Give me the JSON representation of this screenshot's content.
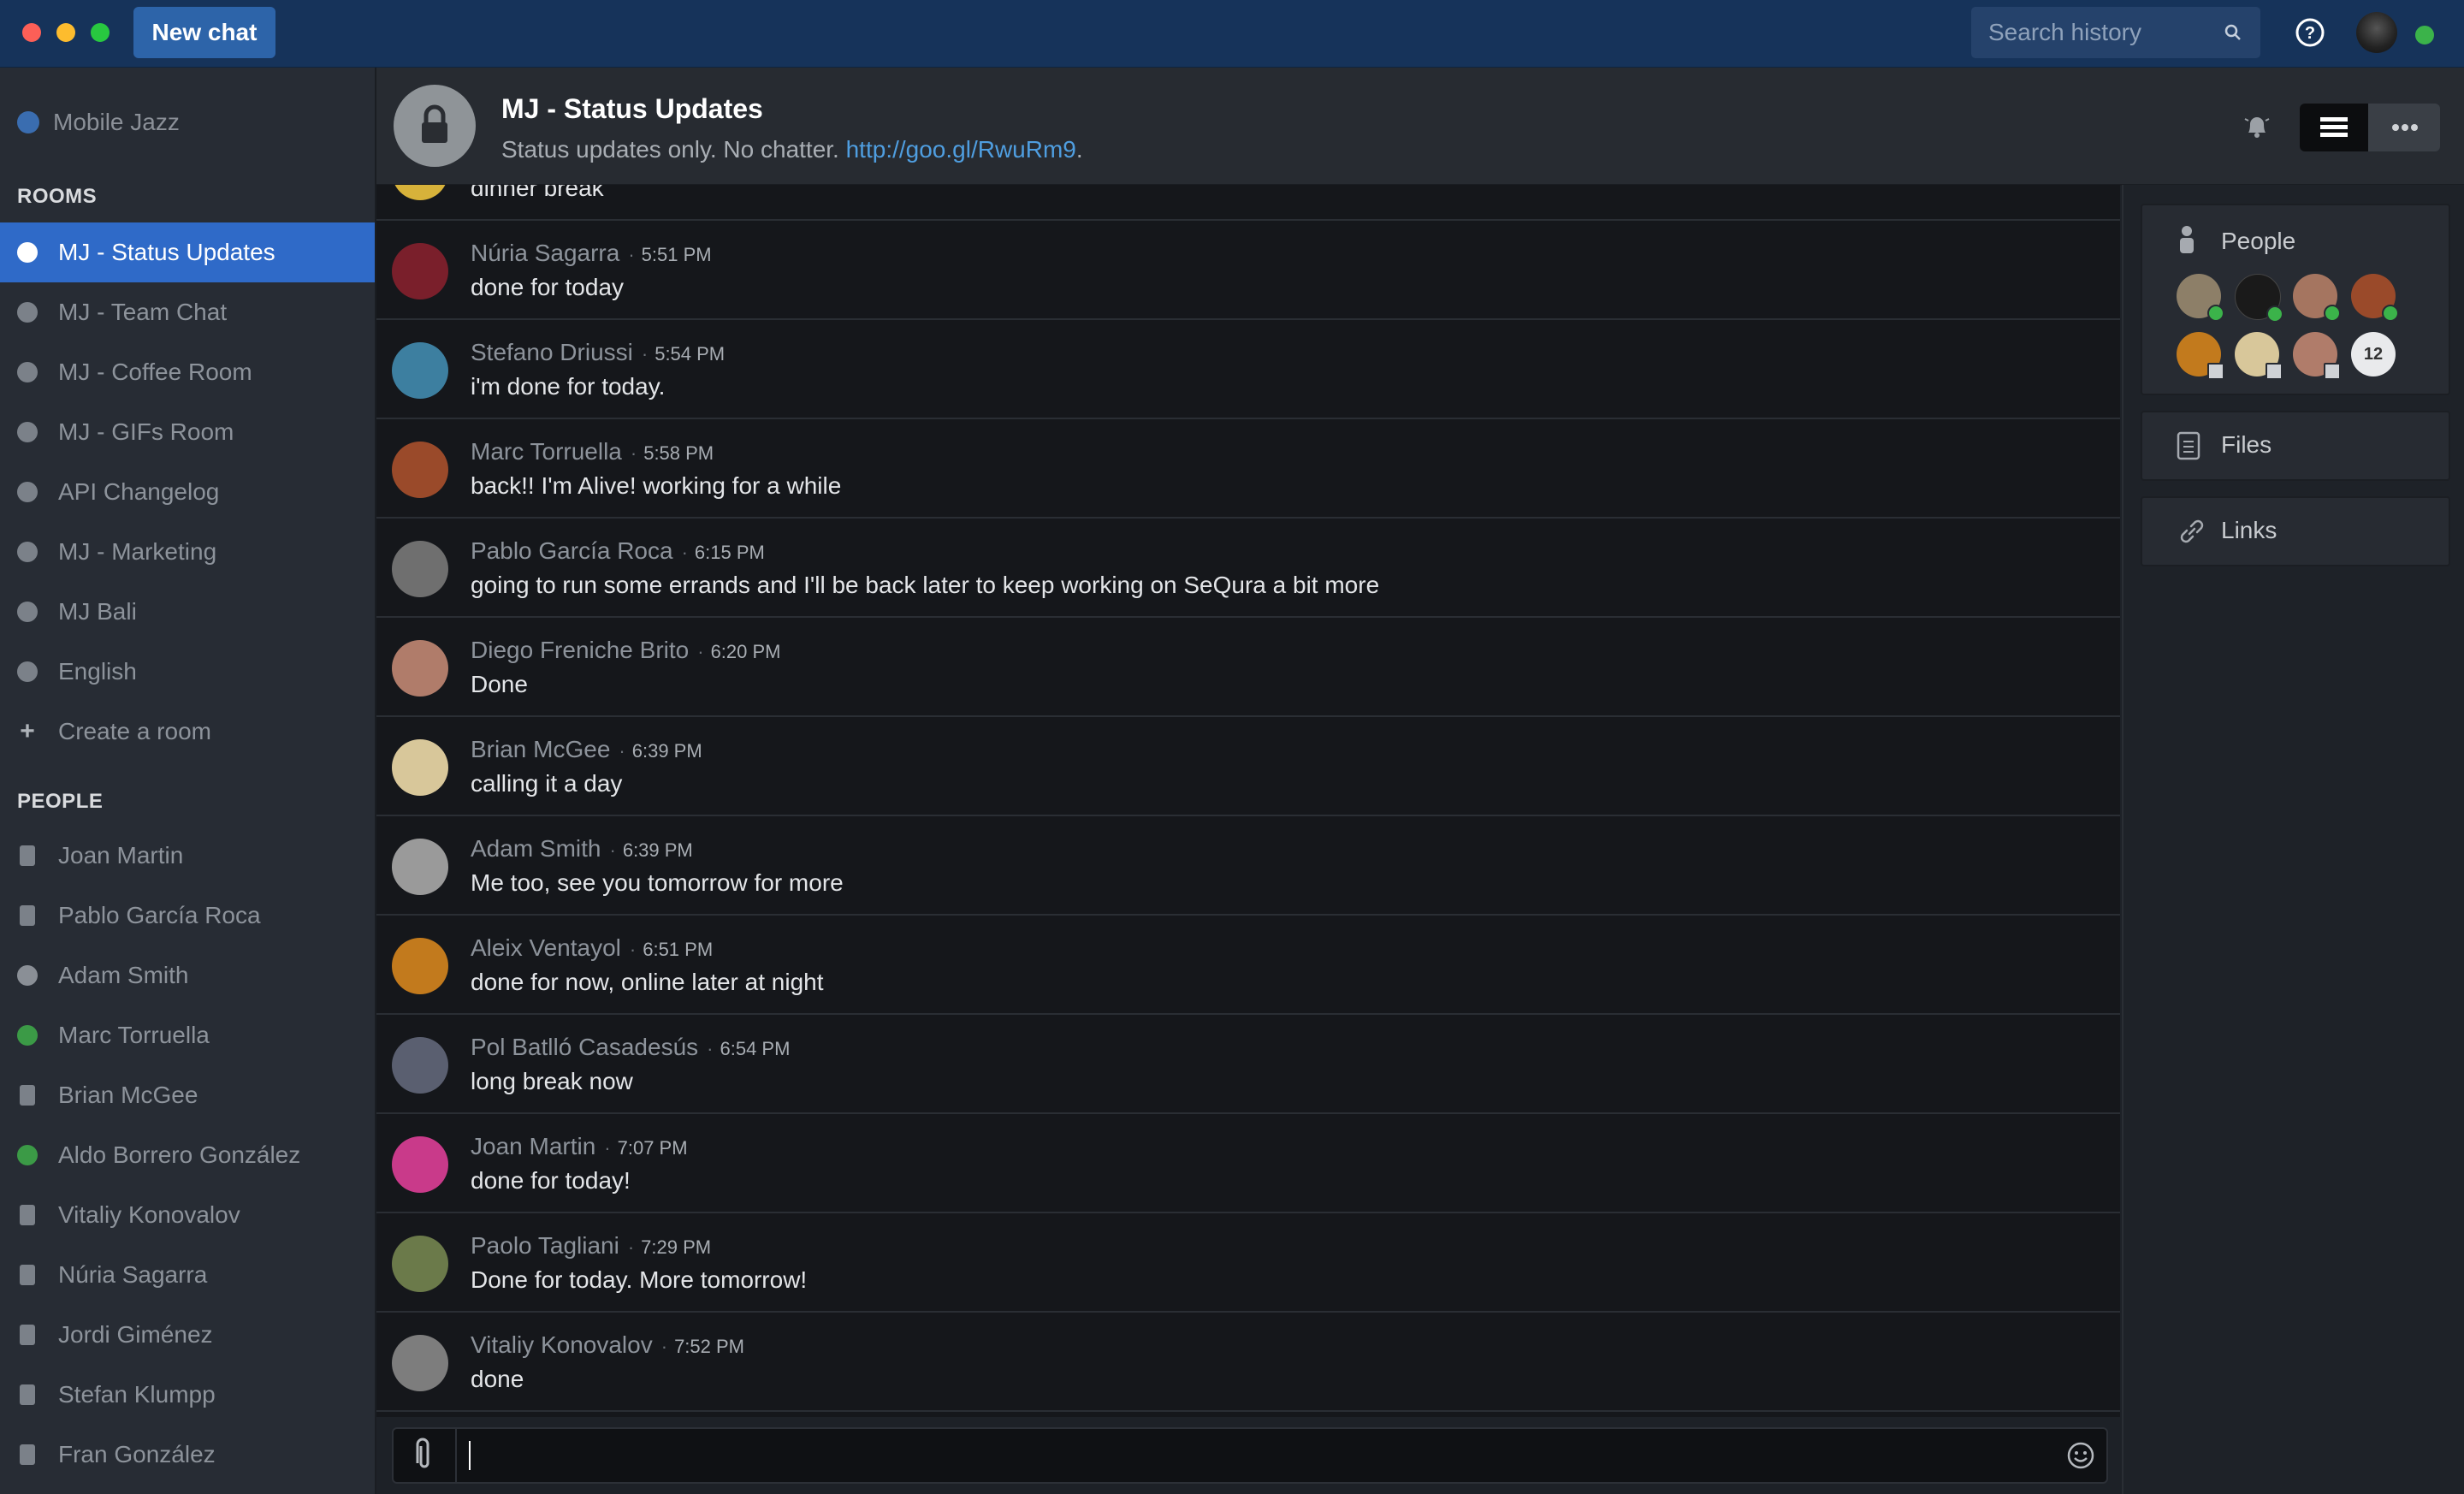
{
  "titlebar": {
    "new_chat_label": "New chat",
    "search_placeholder": "Search history"
  },
  "sidebar": {
    "team_name": "Mobile Jazz",
    "rooms_heading": "ROOMS",
    "rooms": [
      {
        "label": "MJ - Status Updates",
        "icon": "lock-icon",
        "active": true
      },
      {
        "label": "MJ - Team Chat",
        "icon": "lock-icon"
      },
      {
        "label": "MJ - Coffee Room",
        "icon": "room-icon"
      },
      {
        "label": "MJ - GIFs Room",
        "icon": "room-icon"
      },
      {
        "label": "API Changelog",
        "icon": "room-icon"
      },
      {
        "label": "MJ - Marketing",
        "icon": "room-icon"
      },
      {
        "label": "MJ Bali",
        "icon": "room-icon"
      },
      {
        "label": "English",
        "icon": "room-icon"
      }
    ],
    "create_room_label": "Create a room",
    "people_heading": "PEOPLE",
    "people": [
      {
        "label": "Joan Martin",
        "status": "mobile"
      },
      {
        "label": "Pablo García Roca",
        "status": "mobile"
      },
      {
        "label": "Adam Smith",
        "status": "away"
      },
      {
        "label": "Marc Torruella",
        "status": "online"
      },
      {
        "label": "Brian McGee",
        "status": "mobile"
      },
      {
        "label": "Aldo Borrero González",
        "status": "online"
      },
      {
        "label": "Vitaliy Konovalov",
        "status": "mobile"
      },
      {
        "label": "Núria Sagarra",
        "status": "mobile"
      },
      {
        "label": "Jordi Giménez",
        "status": "mobile"
      },
      {
        "label": "Stefan Klumpp",
        "status": "mobile"
      },
      {
        "label": "Fran González",
        "status": "mobile"
      }
    ]
  },
  "header": {
    "room_title": "MJ - Status Updates",
    "topic_text": "Status updates only. No chatter. ",
    "topic_link": "http://goo.gl/RwuRm9",
    "topic_end": "."
  },
  "messages": {
    "partial_text": "dinner break",
    "items": [
      {
        "author": "Núria Sagarra",
        "time": "5:51 PM",
        "text": "done for today",
        "avatar_color": "#7a1f2b"
      },
      {
        "author": "Stefano Driussi",
        "time": "5:54 PM",
        "text": "i'm done for today.",
        "avatar_color": "#3d7fa0"
      },
      {
        "author": "Marc Torruella",
        "time": "5:58 PM",
        "text": "back!! I'm Alive! working for a while",
        "avatar_color": "#9a4a2a"
      },
      {
        "author": "Pablo García Roca",
        "time": "6:15 PM",
        "text": "going to run some errands and I'll be back later to keep working on SeQura a bit more",
        "avatar_color": "#6f6f6f"
      },
      {
        "author": "Diego Freniche Brito",
        "time": "6:20 PM",
        "text": "Done",
        "avatar_color": "#b07c6a"
      },
      {
        "author": "Brian McGee",
        "time": "6:39 PM",
        "text": "calling it a day",
        "avatar_color": "#d8c79a"
      },
      {
        "author": "Adam Smith",
        "time": "6:39 PM",
        "text": "Me too, see you tomorrow for more",
        "avatar_color": "#9a9a9a"
      },
      {
        "author": "Aleix Ventayol",
        "time": "6:51 PM",
        "text": "done for now, online later at night",
        "avatar_color": "#c27a1d"
      },
      {
        "author": "Pol Batlló Casadesús",
        "time": "6:54 PM",
        "text": "long break now",
        "avatar_color": "#5a5f70"
      },
      {
        "author": "Joan Martin",
        "time": "7:07 PM",
        "text": "done for today!",
        "avatar_color": "#c93a8a"
      },
      {
        "author": "Paolo Tagliani",
        "time": "7:29 PM",
        "text": "Done for today. More tomorrow!",
        "avatar_color": "#6b7a4a"
      },
      {
        "author": "Vitaliy Konovalov",
        "time": "7:52 PM",
        "text": "done",
        "avatar_color": "#7d7d7d"
      }
    ]
  },
  "right_panel": {
    "people_title": "People",
    "people_count": "12",
    "files_title": "Files",
    "links_title": "Links"
  },
  "colors": {
    "accent": "#2f6ac8",
    "online": "#3bb34a",
    "link": "#4f9ee0"
  }
}
